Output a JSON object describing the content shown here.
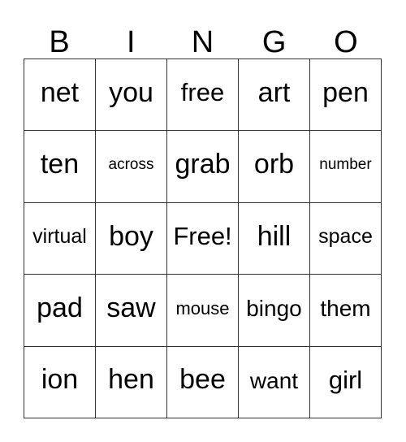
{
  "card": {
    "title": "BINGO",
    "header_letters": [
      "B",
      "I",
      "N",
      "G",
      "O"
    ],
    "free_space_label": "Free!",
    "border_color": "#333333",
    "text_color": "#000000",
    "background_color": "#ffffff",
    "rows": 5,
    "columns": 5,
    "cells": [
      [
        {
          "label": "net",
          "size": "fs-xl"
        },
        {
          "label": "you",
          "size": "fs-xl"
        },
        {
          "label": "free",
          "size": "fs-lg"
        },
        {
          "label": "art",
          "size": "fs-xl"
        },
        {
          "label": "pen",
          "size": "fs-xl"
        }
      ],
      [
        {
          "label": "ten",
          "size": "fs-xl"
        },
        {
          "label": "across",
          "size": "fs-xxs"
        },
        {
          "label": "grab",
          "size": "fs-xl"
        },
        {
          "label": "orb",
          "size": "fs-xl"
        },
        {
          "label": "number",
          "size": "fs-xxs"
        }
      ],
      [
        {
          "label": "virtual",
          "size": "fs-sm"
        },
        {
          "label": "boy",
          "size": "fs-xl"
        },
        {
          "label": "Free!",
          "size": "fs-lg"
        },
        {
          "label": "hill",
          "size": "fs-xl"
        },
        {
          "label": "space",
          "size": "fs-sm"
        }
      ],
      [
        {
          "label": "pad",
          "size": "fs-xl"
        },
        {
          "label": "saw",
          "size": "fs-xl"
        },
        {
          "label": "mouse",
          "size": "fs-xs"
        },
        {
          "label": "bingo",
          "size": "fs-md"
        },
        {
          "label": "them",
          "size": "fs-md"
        }
      ],
      [
        {
          "label": "ion",
          "size": "fs-xl"
        },
        {
          "label": "hen",
          "size": "fs-xl"
        },
        {
          "label": "bee",
          "size": "fs-xl"
        },
        {
          "label": "want",
          "size": "fs-md"
        },
        {
          "label": "girl",
          "size": "fs-lg"
        }
      ]
    ]
  }
}
